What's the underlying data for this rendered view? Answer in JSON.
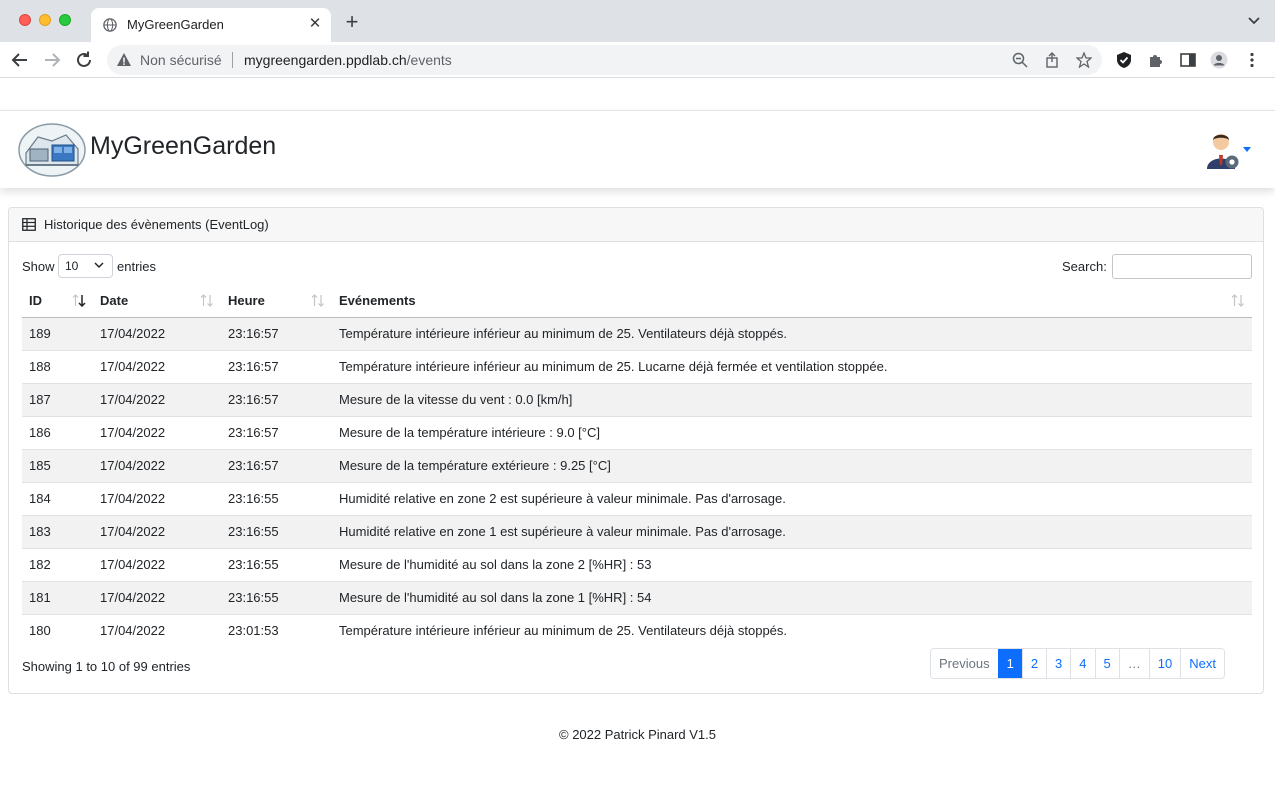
{
  "browser": {
    "tab_title": "MyGreenGarden",
    "security_label": "Non sécurisé",
    "url_domain": "mygreengarden.ppdlab.ch",
    "url_path": "/events"
  },
  "navbar": {
    "brand": "MyGreenGarden"
  },
  "card": {
    "title": "Historique des évènements (EventLog)",
    "show_label": "Show",
    "show_value": "10",
    "entries_label": "entries",
    "search_label": "Search:",
    "search_value": ""
  },
  "table": {
    "columns": [
      "ID",
      "Date",
      "Heure",
      "Evénements"
    ],
    "rows": [
      [
        "189",
        "17/04/2022",
        "23:16:57",
        "Température intérieure inférieur au minimum de 25. Ventilateurs déjà stoppés."
      ],
      [
        "188",
        "17/04/2022",
        "23:16:57",
        "Température intérieure inférieur au minimum de 25. Lucarne déjà fermée et ventilation stoppée."
      ],
      [
        "187",
        "17/04/2022",
        "23:16:57",
        "Mesure de la vitesse du vent : 0.0 [km/h]"
      ],
      [
        "186",
        "17/04/2022",
        "23:16:57",
        "Mesure de la température intérieure : 9.0 [°C]"
      ],
      [
        "185",
        "17/04/2022",
        "23:16:57",
        "Mesure de la température extérieure : 9.25 [°C]"
      ],
      [
        "184",
        "17/04/2022",
        "23:16:55",
        "Humidité relative en zone 2 est supérieure à valeur minimale. Pas d'arrosage."
      ],
      [
        "183",
        "17/04/2022",
        "23:16:55",
        "Humidité relative en zone 1 est supérieure à valeur minimale. Pas d'arrosage."
      ],
      [
        "182",
        "17/04/2022",
        "23:16:55",
        "Mesure de l'humidité au sol dans la zone 2 [%HR] : 53"
      ],
      [
        "181",
        "17/04/2022",
        "23:16:55",
        "Mesure de l'humidité au sol dans la zone 1 [%HR] : 54"
      ],
      [
        "180",
        "17/04/2022",
        "23:01:53",
        "Température intérieure inférieur au minimum de 25. Ventilateurs déjà stoppés."
      ]
    ]
  },
  "info": "Showing 1 to 10 of 99 entries",
  "pagination": {
    "previous": "Previous",
    "pages": [
      "1",
      "2",
      "3",
      "4",
      "5",
      "…",
      "10"
    ],
    "active": "1",
    "next": "Next"
  },
  "footer": "© 2022 Patrick Pinard V1.5",
  "colors": {
    "accent": "#0d6efd",
    "stripe": "#f2f2f2"
  }
}
